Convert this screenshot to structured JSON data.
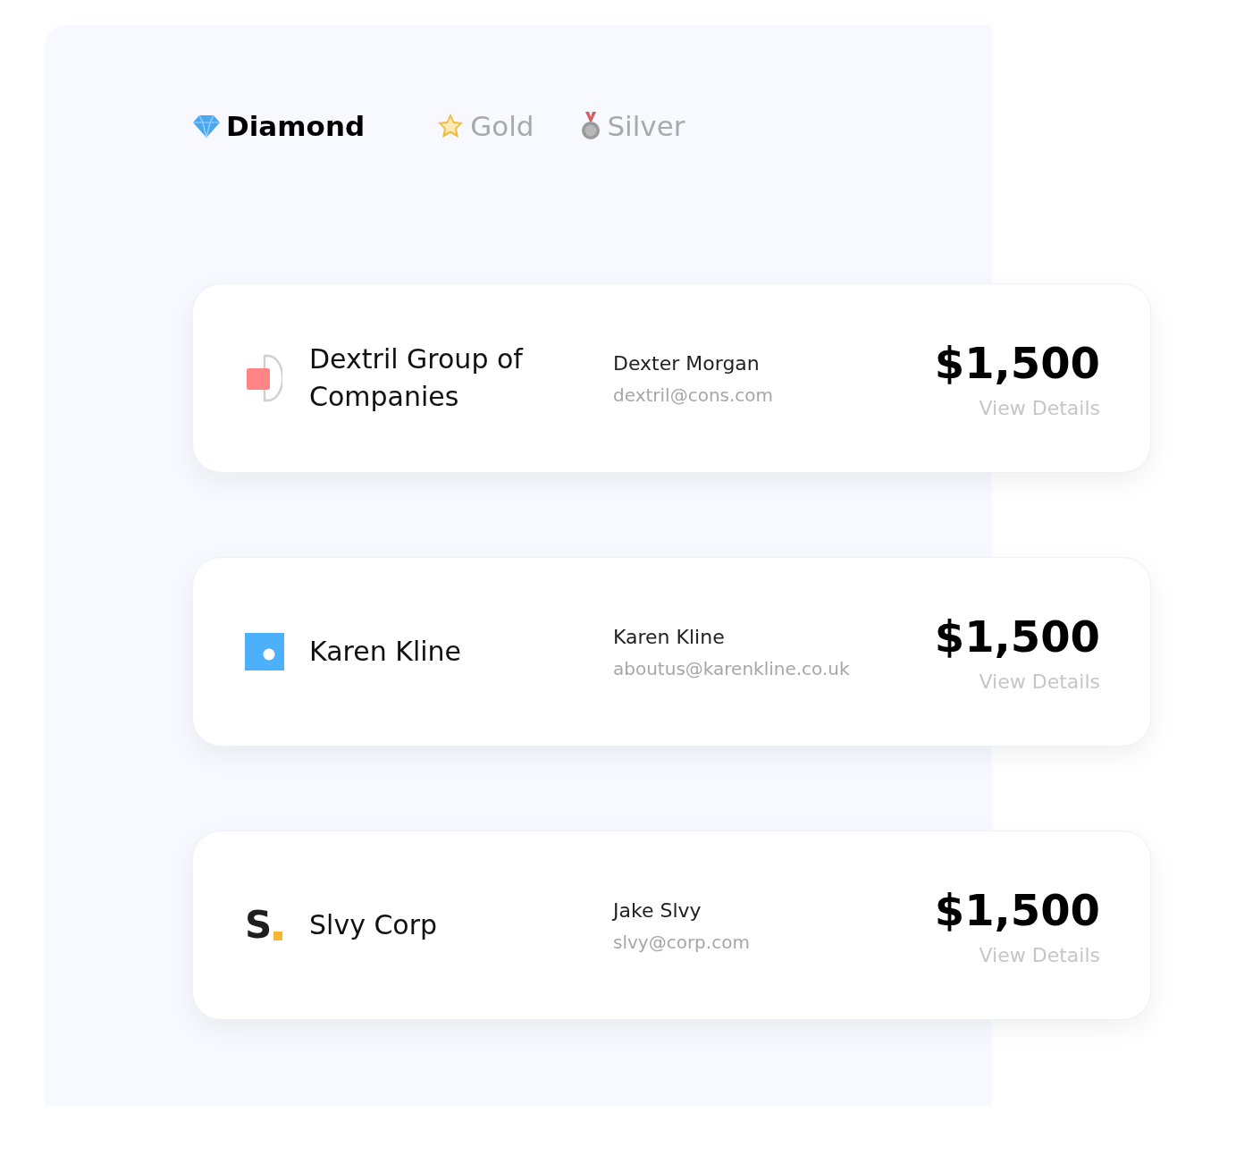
{
  "tabs": [
    {
      "label": "Diamond",
      "kind": "diamond",
      "selected": true
    },
    {
      "label": "Gold",
      "kind": "star",
      "selected": false
    },
    {
      "label": "Silver",
      "kind": "medal",
      "selected": false
    }
  ],
  "clients": [
    {
      "company": "Dextril Group of Companies",
      "logo": {
        "kind": "d-square"
      },
      "contact": "Dexter Morgan",
      "email": "dextril@cons.com",
      "amount": "$1,500",
      "link": "View Details"
    },
    {
      "company": "Karen Kline",
      "logo": {
        "kind": "blue-square"
      },
      "contact": "Karen Kline",
      "email": "aboutus@karenkline.co.uk",
      "amount": "$1,500",
      "link": "View Details"
    },
    {
      "company": "Slvy Corp",
      "logo": {
        "kind": "letter",
        "letter": "S"
      },
      "contact": "Jake Slvy",
      "email": "slvy@corp.com",
      "amount": "$1,500",
      "link": "View Details"
    }
  ]
}
